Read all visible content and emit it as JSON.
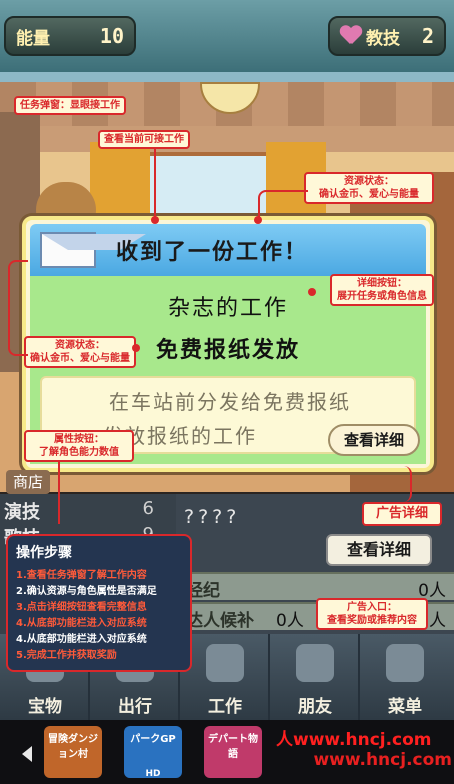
{
  "hud": {
    "energy_label": "能量",
    "energy_value": "10",
    "skill_label": "教技",
    "skill_value": "2"
  },
  "dialog": {
    "title": "收到了一份工作！",
    "job_type": "杂志的工作",
    "job_name": "免费报纸发放",
    "description_line1": "在车站前分发给免费报纸",
    "description_line2": "发放报纸的工作",
    "detail_button": "查看详细"
  },
  "lower_panel": {
    "shop_label": "商店",
    "attributes": [
      {
        "label": "演技",
        "value": "6"
      },
      {
        "label": "歌技",
        "value": "9"
      }
    ],
    "unknown_value": "????",
    "detail_button": "查看详细",
    "staff_rows": [
      {
        "name": "经纪",
        "count": "0人"
      },
      {
        "name": "达人候补",
        "count_left": "0人",
        "count": "0人"
      }
    ]
  },
  "nav": {
    "items": [
      {
        "label": "宝物",
        "icon": "treasure-icon"
      },
      {
        "label": "出行",
        "icon": "travel-icon"
      },
      {
        "label": "工作",
        "icon": "work-icon"
      },
      {
        "label": "朋友",
        "icon": "friends-icon"
      },
      {
        "label": "菜单",
        "icon": "menu-icon"
      }
    ]
  },
  "ads": {
    "tiles": [
      {
        "title": "冒険ダンジョン村",
        "badge": "HD",
        "color": "#c0662a"
      },
      {
        "title": "パークGP",
        "badge": "HD",
        "color": "#2a72c0"
      },
      {
        "title": "デパート物語",
        "badge": "HD",
        "color": "#c03a6a"
      }
    ],
    "watermark_line1": "人www.hncj.com",
    "watermark_line2": "www.hncj.com"
  },
  "annotations": {
    "popup_label": "任务弹窗：显眼接工作",
    "view_jobs": "查看当前可接工作",
    "resource_state_top_1": "资源状态：",
    "resource_state_top_2": "确认金币、爱心与能量",
    "detail_button_1": "详细按钮：",
    "detail_button_2": "展开任务或角色信息",
    "resource_state_left_1": "资源状态：",
    "resource_state_left_2": "确认金币、爱心与能量",
    "attr_button_1": "属性按钮：",
    "attr_button_2": "了解角色能力数值",
    "ad_detail": "广告详细",
    "ad_entry_1": "广告入口：",
    "ad_entry_2": "查看奖励或推荐内容",
    "steps_title": "操作步骤",
    "steps": [
      "1.查看任务弹窗了解工作内容",
      "2.确认资源与角色属性是否满足",
      "3.点击详细按钮查看完整信息",
      "4.从底部功能栏进入对应系统",
      "4.从底部功能栏进入对应系统",
      "5.完成工作并获取奖励"
    ]
  }
}
